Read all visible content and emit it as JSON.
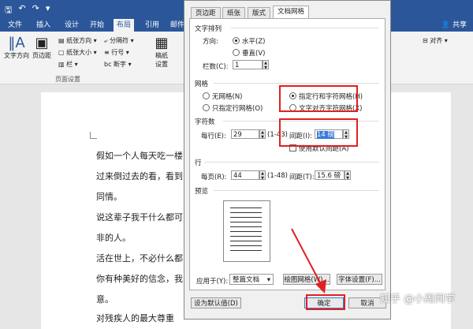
{
  "titlebar": {
    "share": "共享"
  },
  "tabs": [
    "文件",
    "插入",
    "设计",
    "开始",
    "布局",
    "引用",
    "邮件"
  ],
  "ribbon": {
    "text_direction": "文字方向",
    "margins": "页边距",
    "size_orient": "纸张方向",
    "paper_size": "纸张大小",
    "columns": "栏",
    "breaks": "分隔符",
    "line_numbers": "行号",
    "hyphenation": "断字",
    "draft": "稿纸设置",
    "group_page_setup": "页面设置",
    "align": "对齐"
  },
  "document": {
    "lines": [
      "假如一个人每天吃一楼",
      "过来倒过去的看，看到",
      "同情。",
      "说这辈子我干什么都可",
      "非的人。",
      "活在世上，不必什么都",
      "你有种美好的信念，我",
      "意。",
      "对残疾人的最大尊重"
    ]
  },
  "dialog": {
    "tabs": [
      "页边距",
      "纸张",
      "版式",
      "文档网格"
    ],
    "text_arrangement": {
      "title": "文字排列",
      "direction_label": "方向:",
      "horizontal": "水平(Z)",
      "vertical": "垂直(V)",
      "columns_label": "栏数(C):",
      "columns_value": "1"
    },
    "grid": {
      "title": "网格",
      "none": "无网格(N)",
      "line_only": "只指定行网格(O)",
      "line_and_char": "指定行和字符网格(H)",
      "align_chars": "文字对齐字符网格(X)"
    },
    "chars": {
      "title": "字符数",
      "per_line_label": "每行(E):",
      "per_line_value": "29",
      "range": "(1-43)",
      "pitch_label": "间距(I):",
      "pitch_value": "14 磅",
      "use_default": "使用默认间距(A)"
    },
    "lines": {
      "title": "行",
      "per_page_label": "每页(R):",
      "per_page_value": "44",
      "range": "(1-48)",
      "pitch_label": "间距(T):",
      "pitch_value": "15.6 磅"
    },
    "preview": {
      "title": "预览"
    },
    "apply_label": "应用于(Y):",
    "apply_value": "整篇文档",
    "draw_grid": "绘图网格(W)...",
    "font_settings": "字体设置(F)...",
    "set_default": "设为默认值(D)",
    "ok": "确定",
    "cancel": "取消"
  },
  "watermark": "知乎 @小周同学",
  "colors": {
    "accent": "#2b579a",
    "highlight": "#e02020"
  }
}
